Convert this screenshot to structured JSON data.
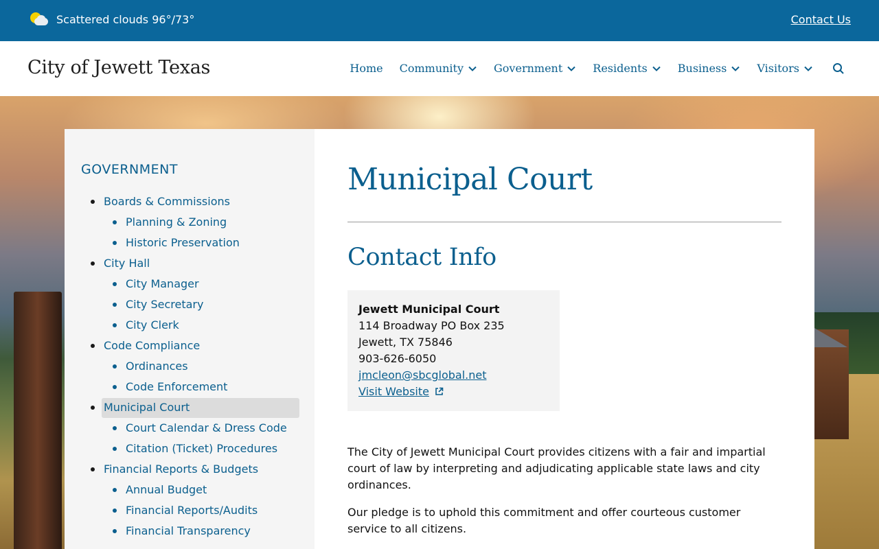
{
  "topbar": {
    "weather_text": "Scattered clouds 96°/73°",
    "weather_icon": "partly-cloudy-icon",
    "contact_label": "Contact Us"
  },
  "header": {
    "site_title": "City of Jewett Texas",
    "nav": [
      {
        "label": "Home",
        "has_dropdown": false
      },
      {
        "label": "Community",
        "has_dropdown": true
      },
      {
        "label": "Government",
        "has_dropdown": true
      },
      {
        "label": "Residents",
        "has_dropdown": true
      },
      {
        "label": "Business",
        "has_dropdown": true
      },
      {
        "label": "Visitors",
        "has_dropdown": true
      }
    ],
    "search_icon": "search-icon"
  },
  "sidebar": {
    "heading": "GOVERNMENT",
    "items": [
      {
        "label": "Boards & Commissions",
        "level": 1
      },
      {
        "label": "Planning & Zoning",
        "level": 2
      },
      {
        "label": "Historic Preservation",
        "level": 2
      },
      {
        "label": "City Hall",
        "level": 1
      },
      {
        "label": "City Manager",
        "level": 2
      },
      {
        "label": "City Secretary",
        "level": 2
      },
      {
        "label": "City Clerk",
        "level": 2
      },
      {
        "label": "Code Compliance",
        "level": 1
      },
      {
        "label": "Ordinances",
        "level": 2
      },
      {
        "label": "Code Enforcement",
        "level": 2
      },
      {
        "label": "Municipal Court",
        "level": 1,
        "active": true
      },
      {
        "label": "Court Calendar & Dress Code",
        "level": 2
      },
      {
        "label": "Citation (Ticket) Procedures",
        "level": 2
      },
      {
        "label": "Financial Reports & Budgets",
        "level": 1
      },
      {
        "label": "Annual Budget",
        "level": 2
      },
      {
        "label": "Financial Reports/Audits",
        "level": 2
      },
      {
        "label": "Financial Transparency",
        "level": 2
      }
    ]
  },
  "main": {
    "page_title": "Municipal Court",
    "section_title": "Contact Info",
    "contact": {
      "name": "Jewett Municipal Court",
      "address1": "114 Broadway PO Box 235",
      "address2": "Jewett, TX 75846",
      "phone": "903-626-6050",
      "email": "jmcleon@sbcglobal.net",
      "website_label": "Visit Website"
    },
    "paragraphs": [
      "The City of Jewett Municipal Court provides citizens with a fair and impartial court of law by interpreting and adjudicating applicable state laws and city ordinances.",
      "Our pledge is to uphold this commitment and offer courteous customer service to all citizens."
    ]
  },
  "colors": {
    "topbar_bg": "#0b679c",
    "link_blue": "#0b5f8e",
    "sidebar_bg": "#f5f5f5",
    "active_bg": "#dcdcdc"
  }
}
